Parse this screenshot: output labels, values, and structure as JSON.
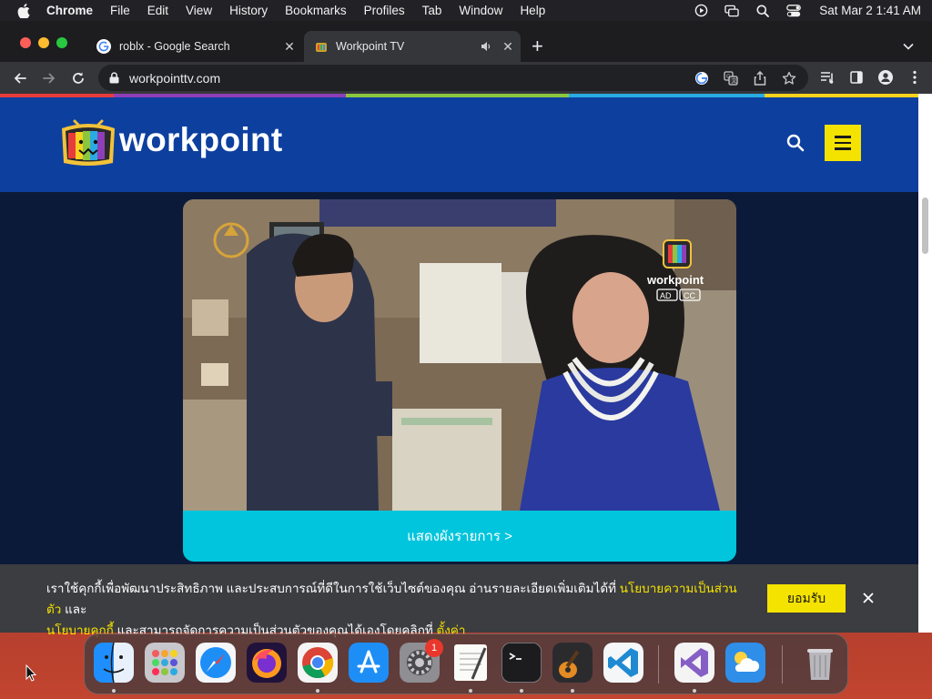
{
  "menubar": {
    "app_name": "Chrome",
    "menus": [
      "File",
      "Edit",
      "View",
      "History",
      "Bookmarks",
      "Profiles",
      "Tab",
      "Window",
      "Help"
    ],
    "clock": "Sat Mar 2  1:41 AM",
    "status_icons": [
      "play-circle-icon",
      "screen-mirroring-icon",
      "spotlight-search-icon",
      "control-center-icon"
    ]
  },
  "browser": {
    "tabs": [
      {
        "title": "roblx - Google Search",
        "favicon": "google-icon",
        "active": false
      },
      {
        "title": "Workpoint TV",
        "favicon": "workpoint-icon",
        "active": true,
        "audio": true
      }
    ],
    "new_tab_label": "+",
    "url": "workpointtv.com",
    "colors": {
      "tabstrip": "#1d1d20",
      "toolbar": "#35363a",
      "omnibox": "#202124"
    }
  },
  "site": {
    "brand": "workpoint",
    "header_color": "#0d3f9f",
    "accent_yellow": "#f4e200",
    "accent_cyan": "#00c5dc",
    "video_badges": [
      "AD",
      "CC"
    ],
    "video_logo_text": "workpoint",
    "schedule_label": "แสดงผังรายการ >"
  },
  "cookie": {
    "line1": "เราใช้คุกกี้เพื่อพัฒนาประสิทธิภาพ และประสบการณ์ที่ดีในการใช้เว็บไซต์ของคุณ อ่านรายละเอียดเพิ่มเติมได้ที่ ",
    "privacy_link": "นโยบายความเป็นส่วนตัว",
    "and": " และ",
    "cookie_policy_link": "นโยบายคุกกี้",
    "line2": " และสามารถจัดการความเป็นส่วนตัวของคุณได้เองโดยคลิกที่ ",
    "settings_link": "ตั้งค่า",
    "accept_label": "ยอมรับ"
  },
  "dock": {
    "apps": [
      "finder",
      "launchpad",
      "safari",
      "firefox",
      "chrome",
      "app-store",
      "system-settings",
      "textedit",
      "terminal",
      "garageband",
      "vscode",
      "visual-studio",
      "weather",
      "trash"
    ],
    "settings_badge": "1"
  }
}
